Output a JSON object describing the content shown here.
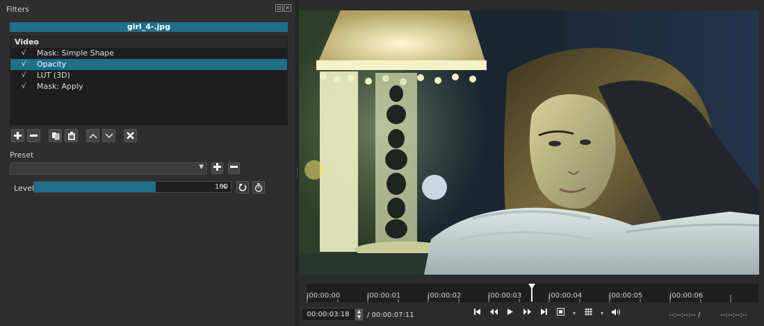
{
  "panel": {
    "title": "Filters",
    "undock_icon": "undock-icon",
    "close_icon": "close-icon"
  },
  "clip": {
    "name": "girl_4-.jpg"
  },
  "filter_list": {
    "group": "Video",
    "items": [
      {
        "check": "√",
        "name": "Mask: Simple Shape",
        "selected": false
      },
      {
        "check": "√",
        "name": "Opacity",
        "selected": true
      },
      {
        "check": "√",
        "name": "LUT (3D)",
        "selected": false
      },
      {
        "check": "√",
        "name": "Mask: Apply",
        "selected": false
      }
    ]
  },
  "toolbar": {
    "add_icon": "plus-icon",
    "remove_icon": "minus-icon",
    "copy_icon": "copy-icon",
    "paste_icon": "paste-icon",
    "up_icon": "chevron-up-icon",
    "down_icon": "chevron-down-icon",
    "deselect_icon": "close-icon"
  },
  "preset": {
    "label": "Preset",
    "value": ""
  },
  "level": {
    "label": "Level",
    "value": "100",
    "unit": "%",
    "fill_fraction": 0.62
  },
  "timeline": {
    "ticks": [
      "|00:00:00",
      "|00:00:01",
      "|00:00:02",
      "|00:00:03",
      "|00:00:04",
      "|00:00:05",
      "|00:00:06"
    ],
    "playhead_fraction": 0.5
  },
  "timecode": {
    "position": "00:00:03:18",
    "duration": "/ 00:00:07:11"
  },
  "inout": {
    "in": "--:--:--:-- /",
    "out": "--:--:--:--"
  },
  "colors": {
    "accent": "#1d6f8c",
    "background": "#2b2b2b"
  }
}
